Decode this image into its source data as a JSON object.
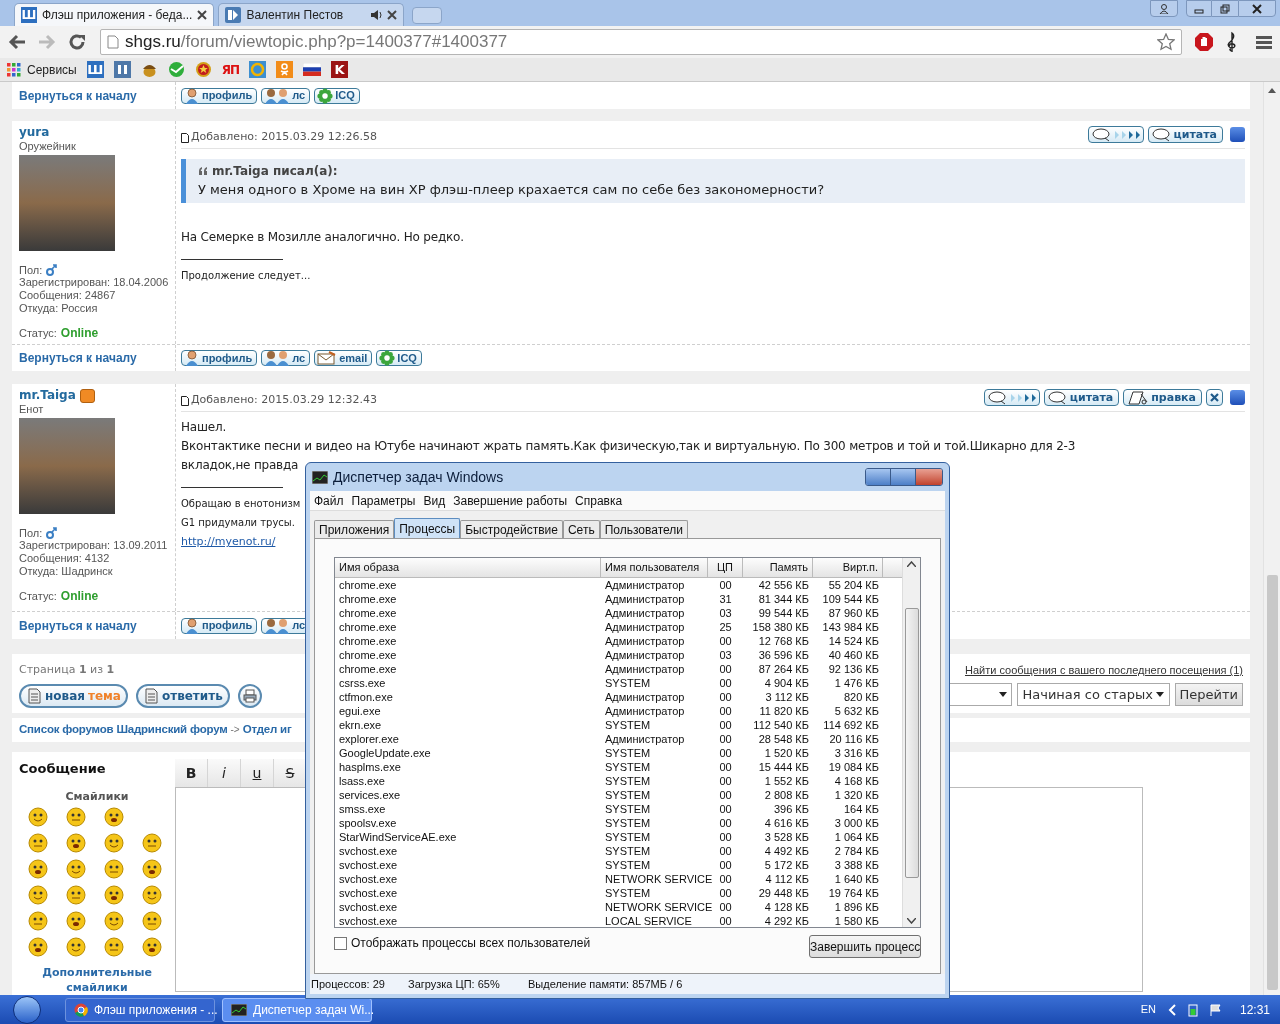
{
  "browser": {
    "tabs": [
      {
        "title": "Флэш приложения - беда...",
        "icon_letter": "Ш",
        "selected": true,
        "audio": false
      },
      {
        "title": "Валентин Пестов",
        "selected": false,
        "audio": true
      }
    ],
    "url": {
      "host": "shgs.ru",
      "path": "/forum/viewtopic.php?p=1400377#1400377"
    },
    "bookmarks": [
      {
        "kind": "apps",
        "label": "Сервисы"
      },
      {
        "kind": "letter",
        "label": "Ш",
        "color": "#2d6fbf"
      },
      {
        "kind": "pause"
      },
      {
        "kind": "acorn"
      },
      {
        "kind": "sber"
      },
      {
        "kind": "star"
      },
      {
        "kind": "text",
        "label": "ЯП"
      },
      {
        "kind": "ring"
      },
      {
        "kind": "ok"
      },
      {
        "kind": "flag"
      },
      {
        "kind": "letter",
        "label": "K",
        "color": "#9b1414"
      }
    ]
  },
  "forum": {
    "top_row": {
      "back_link": "Вернуться к началу",
      "buttons": [
        {
          "kind": "profile",
          "label": "профиль"
        },
        {
          "kind": "pm",
          "label": "лс"
        },
        {
          "kind": "icq",
          "label": "ICQ"
        }
      ]
    },
    "posts": [
      {
        "author": "yura",
        "badge": false,
        "rank": "Оружейник",
        "gender_label": "Пол:",
        "details": [
          "Зарегистрирован: 18.04.2006",
          "Сообщения: 24867",
          "Откуда: Россия"
        ],
        "status_label": "Статус:",
        "status": "Online",
        "posted": "Добавлено: 2015.03.29 12:26.58",
        "actions": [
          {
            "kind": "forward"
          },
          {
            "kind": "quote",
            "label": "цитата"
          }
        ],
        "quote": {
          "author": "mr.Taiga писал(а):",
          "text": "У меня одного в Хроме на вин ХР флэш-плеер крахается сам по себе без закономерности?"
        },
        "body": [
          "На Семерке в Мозилле аналогично. Но редко."
        ],
        "signature": [
          {
            "kind": "text",
            "text": "Продолжение следует..."
          }
        ],
        "back_link": "Вернуться к началу",
        "buttons": [
          {
            "kind": "profile",
            "label": "профиль"
          },
          {
            "kind": "pm",
            "label": "лс"
          },
          {
            "kind": "email",
            "label": "email"
          },
          {
            "kind": "icq",
            "label": "ICQ"
          }
        ]
      },
      {
        "author": "mr.Taiga",
        "badge": true,
        "rank": "Енот",
        "gender_label": "Пол:",
        "details": [
          "Зарегистрирован: 13.09.2011",
          "Сообщения: 4132",
          "Откуда: Шадринск"
        ],
        "status_label": "Статус:",
        "status": "Online",
        "posted": "Добавлено: 2015.03.29 12:32.43",
        "actions": [
          {
            "kind": "forward"
          },
          {
            "kind": "quote",
            "label": "цитата"
          },
          {
            "kind": "edit",
            "label": "правка"
          },
          {
            "kind": "delete"
          }
        ],
        "body": [
          "Нашел.",
          "Вконтактике песни и видео на Ютубе начинают жрать память.Как физическую,так и виртуальную. По 300 метров и той и той.Шикарно для 2-3 вкладок,не правда"
        ],
        "signature": [
          {
            "kind": "text",
            "text": "Обращаю в енотонизм"
          },
          {
            "kind": "text",
            "text": "G1 придумали трусы."
          },
          {
            "kind": "link",
            "text": "http://myenot.ru/"
          }
        ],
        "back_link": "Вернуться к началу",
        "buttons": [
          {
            "kind": "profile",
            "label": "профиль"
          },
          {
            "kind": "pm",
            "label": "лс"
          }
        ]
      }
    ],
    "pagination": {
      "text": "Страница **1** из **1**",
      "buttons": [
        {
          "kind": "new",
          "parts": [
            {
              "text": "новая",
              "accent": false
            },
            {
              "text": "тема",
              "accent": true
            }
          ]
        },
        {
          "kind": "reply",
          "parts": [
            {
              "text": "ответить",
              "accent": false
            }
          ]
        },
        {
          "kind": "print"
        }
      ],
      "find_link": "Найти сообщения с вашего последнего посещения (1)",
      "sort_value": "Начиная со старых",
      "go_button": "Перейти"
    },
    "breadcrumb": {
      "parts": [
        "Список форумов Шадринский форум",
        "->",
        "Отдел иг"
      ]
    },
    "message": {
      "title": "Сообщение",
      "smilies_title": "Смайлики",
      "more_smilies": "Дополнительные смайлики",
      "toolbar": [
        {
          "kind": "bold",
          "label": "B"
        },
        {
          "kind": "italic",
          "label": "i"
        },
        {
          "kind": "underline",
          "label": "u"
        },
        {
          "kind": "strike",
          "label": "S"
        }
      ]
    }
  },
  "task_manager": {
    "title": "Диспетчер задач Windows",
    "menu": [
      "Файл",
      "Параметры",
      "Вид",
      "Завершение работы",
      "Справка"
    ],
    "tabs": [
      {
        "label": "Приложения",
        "selected": false
      },
      {
        "label": "Процессы",
        "selected": true
      },
      {
        "label": "Быстродействие",
        "selected": false
      },
      {
        "label": "Сеть",
        "selected": false
      },
      {
        "label": "Пользователи",
        "selected": false
      }
    ],
    "columns": [
      "Имя образа",
      "Имя пользователя",
      "ЦП",
      "Память",
      "Вирт.п."
    ],
    "rows": [
      [
        "chrome.exe",
        "Администратор",
        "00",
        "42 556 КБ",
        "55 204 КБ"
      ],
      [
        "chrome.exe",
        "Администратор",
        "31",
        "81 344 КБ",
        "109 544 КБ"
      ],
      [
        "chrome.exe",
        "Администратор",
        "03",
        "99 544 КБ",
        "87 960 КБ"
      ],
      [
        "chrome.exe",
        "Администратор",
        "25",
        "158 380 КБ",
        "143 984 КБ"
      ],
      [
        "chrome.exe",
        "Администратор",
        "00",
        "12 768 КБ",
        "14 524 КБ"
      ],
      [
        "chrome.exe",
        "Администратор",
        "03",
        "36 596 КБ",
        "40 460 КБ"
      ],
      [
        "chrome.exe",
        "Администратор",
        "00",
        "87 264 КБ",
        "92 136 КБ"
      ],
      [
        "csrss.exe",
        "SYSTEM",
        "00",
        "4 904 КБ",
        "1 476 КБ"
      ],
      [
        "ctfmon.exe",
        "Администратор",
        "00",
        "3 112 КБ",
        "820 КБ"
      ],
      [
        "egui.exe",
        "Администратор",
        "00",
        "11 820 КБ",
        "5 632 КБ"
      ],
      [
        "ekrn.exe",
        "SYSTEM",
        "00",
        "112 540 КБ",
        "114 692 КБ"
      ],
      [
        "explorer.exe",
        "Администратор",
        "00",
        "28 548 КБ",
        "20 116 КБ"
      ],
      [
        "GoogleUpdate.exe",
        "SYSTEM",
        "00",
        "1 520 КБ",
        "3 316 КБ"
      ],
      [
        "hasplms.exe",
        "SYSTEM",
        "00",
        "15 444 КБ",
        "19 084 КБ"
      ],
      [
        "lsass.exe",
        "SYSTEM",
        "00",
        "1 552 КБ",
        "4 168 КБ"
      ],
      [
        "services.exe",
        "SYSTEM",
        "00",
        "2 808 КБ",
        "1 320 КБ"
      ],
      [
        "smss.exe",
        "SYSTEM",
        "00",
        "396 КБ",
        "164 КБ"
      ],
      [
        "spoolsv.exe",
        "SYSTEM",
        "00",
        "4 616 КБ",
        "3 000 КБ"
      ],
      [
        "StarWindServiceAE.exe",
        "SYSTEM",
        "00",
        "3 528 КБ",
        "1 064 КБ"
      ],
      [
        "svchost.exe",
        "SYSTEM",
        "00",
        "4 492 КБ",
        "2 784 КБ"
      ],
      [
        "svchost.exe",
        "SYSTEM",
        "00",
        "5 172 КБ",
        "3 388 КБ"
      ],
      [
        "svchost.exe",
        "NETWORK SERVICE",
        "00",
        "4 112 КБ",
        "1 640 КБ"
      ],
      [
        "svchost.exe",
        "SYSTEM",
        "00",
        "29 448 КБ",
        "19 764 КБ"
      ],
      [
        "svchost.exe",
        "NETWORK SERVICE",
        "00",
        "4 128 КБ",
        "1 896 КБ"
      ],
      [
        "svchost.exe",
        "LOCAL SERVICE",
        "00",
        "4 292 КБ",
        "1 580 КБ"
      ]
    ],
    "show_all": {
      "label": "Отображать процессы всех пользователей",
      "checked": false
    },
    "end_button": "Завершить процесс",
    "status": [
      "Процессов: 29",
      "Загрузка ЦП: 65%",
      "Выделение памяти: 857МБ / 6"
    ]
  },
  "taskbar": {
    "items": [
      {
        "kind": "chrome",
        "label": "Флэш приложения - ...",
        "selected": false
      },
      {
        "kind": "taskmgr",
        "label": "Диспетчер задач Wi...",
        "selected": true
      }
    ],
    "language": "EN",
    "time": "12:31"
  }
}
